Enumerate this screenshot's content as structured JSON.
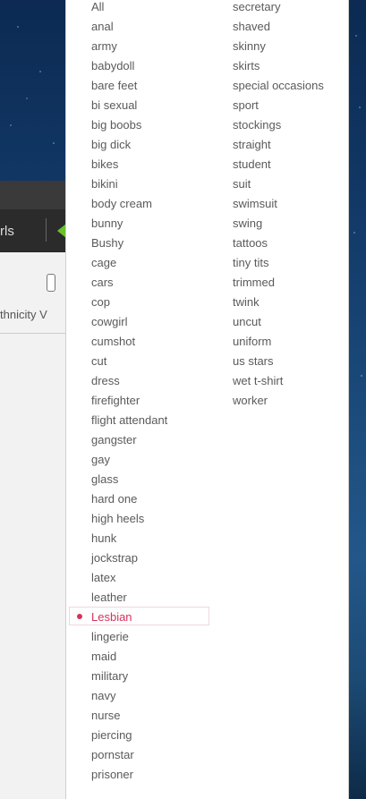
{
  "background_page": {
    "nav_text": "rls",
    "filter_label": "thnicity",
    "filter_chevron": "V"
  },
  "dropdown": {
    "selected": "Lesbian",
    "accent_color": "#d6325a",
    "column1": [
      "All",
      "anal",
      "army",
      "babydoll",
      "bare feet",
      "bi sexual",
      "big boobs",
      "big dick",
      "bikes",
      "bikini",
      "body cream",
      "bunny",
      "Bushy",
      "cage",
      "cars",
      "cop",
      "cowgirl",
      "cumshot",
      "cut",
      "dress",
      "firefighter",
      "flight attendant",
      "gangster",
      "gay",
      "glass",
      "hard one",
      "high heels",
      "hunk",
      "jockstrap",
      "latex",
      "leather",
      "Lesbian",
      "lingerie",
      "maid",
      "military",
      "navy",
      "nurse",
      "piercing",
      "pornstar",
      "prisoner"
    ],
    "column2": [
      "secretary",
      "shaved",
      "skinny",
      "skirts",
      "special occasions",
      "sport",
      "stockings",
      "straight",
      "student",
      "suit",
      "swimsuit",
      "swing",
      "tattoos",
      "tiny tits",
      "trimmed",
      "twink",
      "uncut",
      "uniform",
      "us stars",
      "wet t-shirt",
      "worker"
    ]
  }
}
